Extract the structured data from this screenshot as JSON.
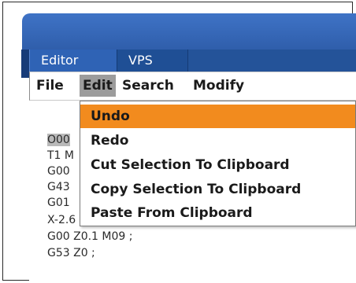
{
  "tabs": [
    {
      "label": "Editor"
    },
    {
      "label": "VPS"
    }
  ],
  "menu": {
    "file": "File",
    "edit": "Edit",
    "search": "Search",
    "modify": "Modify"
  },
  "dropdown": {
    "items": [
      {
        "label": "Undo",
        "highlighted": true
      },
      {
        "label": "Redo"
      },
      {
        "label": "Cut Selection To Clipboard"
      },
      {
        "label": "Copy Selection To Clipboard"
      },
      {
        "label": "Paste From Clipboard"
      }
    ]
  },
  "code": {
    "lines": [
      "O00",
      "T1 M",
      "G00",
      "G43",
      "G01",
      "X-2.6 ;",
      "G00 Z0.1 M09 ;",
      "G53 Z0 ;"
    ]
  },
  "colors": {
    "highlight": "#f28b1e",
    "titlebar": "#3f73c6",
    "tabstrip": "#1f4f95"
  }
}
